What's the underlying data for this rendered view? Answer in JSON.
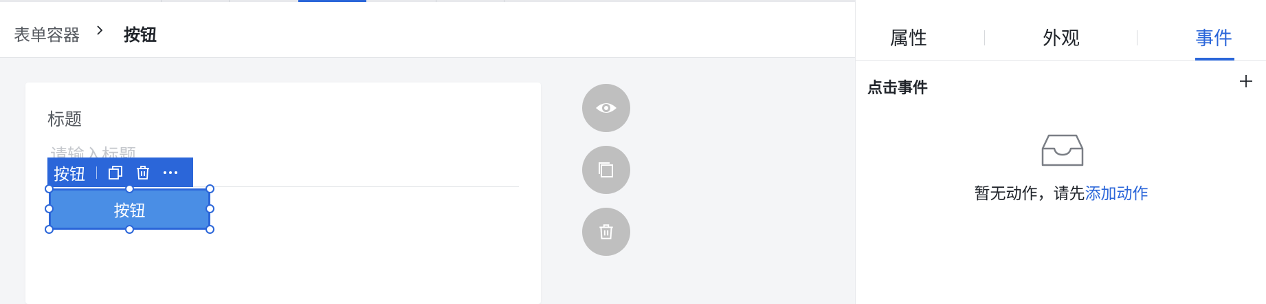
{
  "breadcrumb": {
    "parent": "表单容器",
    "current": "按钮"
  },
  "form": {
    "field_label": "标题",
    "field_placeholder": "请输入标题"
  },
  "selection_toolbar": {
    "label": "按钮",
    "icons": [
      "copy-icon",
      "trash-icon",
      "more-icon"
    ]
  },
  "selected_button": {
    "label": "按钮"
  },
  "side_actions": [
    "eye-icon",
    "copy-icon",
    "trash-icon"
  ],
  "panel": {
    "tabs": [
      {
        "label": "属性",
        "active": false
      },
      {
        "label": "外观",
        "active": false
      },
      {
        "label": "事件",
        "active": true
      }
    ],
    "section_title": "点击事件",
    "empty_text": "暂无动作，请先",
    "empty_link": "添加动作"
  },
  "colors": {
    "accent": "#2b66d9",
    "button_fill": "#4a8ee5",
    "circle_gray": "#bfbfbf"
  }
}
